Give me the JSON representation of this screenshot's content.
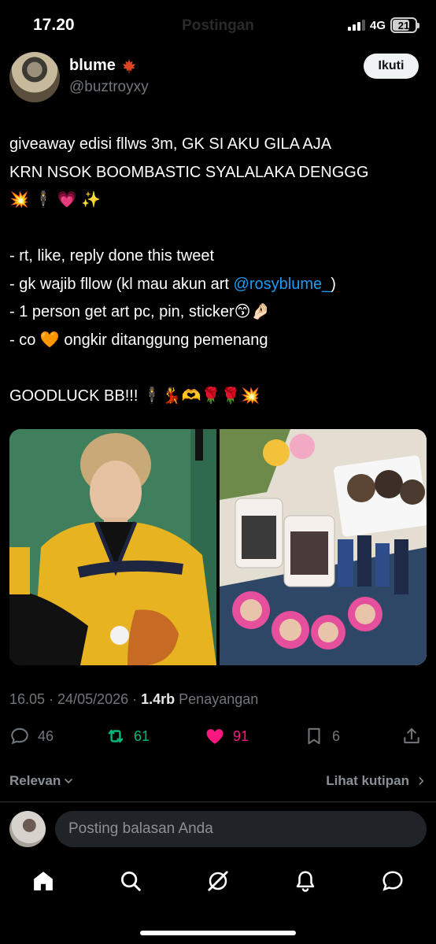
{
  "status_bar": {
    "time": "17.20",
    "ghost_title": "Postingan",
    "network": "4G",
    "battery": "21"
  },
  "author": {
    "display_name": "blume",
    "handle": "@buztroyxy",
    "badge_icon": "maple-leaf-icon",
    "follow_label": "Ikuti"
  },
  "tweet": {
    "line1": "giveaway edisi fllws 3m, GK SI AKU GILA AJA",
    "line2": "KRN NSOK BOOMBASTIC SYALALAKA DENGGG",
    "line3_emoji": "💥 🕴 💗 ✨",
    "rule1": "- rt, like, reply done this tweet",
    "rule2_prefix": "- gk wajib fllow (kl mau akun art ",
    "rule2_mention": "@rosyblume_",
    "rule2_suffix": ")",
    "rule3": "- 1 person get art pc, pin, sticker😙🤌🏻",
    "rule4": "- co 🧡 ongkir ditanggung pemenang",
    "closing": "GOODLUCK BB!!! 🕴💃🫶🌹🌹💥"
  },
  "media": {
    "left_photo": "baseball-jersey-photo",
    "right_photo": "merch-collection-photo"
  },
  "meta": {
    "timestamp": "16.05 · 24/05/2026 · ",
    "views_count": "1.4rb",
    "views_label": "Penayangan"
  },
  "actions": {
    "replies": "46",
    "retweets": "61",
    "likes": "91",
    "bookmarks": "6",
    "colors": {
      "retweet": "#00ba7c",
      "like": "#f91880",
      "muted": "#71767b"
    }
  },
  "sort": {
    "left_label": "Relevan",
    "right_label": "Lihat kutipan"
  },
  "reply": {
    "placeholder": "Posting balasan Anda"
  },
  "nav": {
    "items": [
      "home-icon",
      "search-icon",
      "grok-icon",
      "notifications-icon",
      "messages-icon"
    ]
  }
}
